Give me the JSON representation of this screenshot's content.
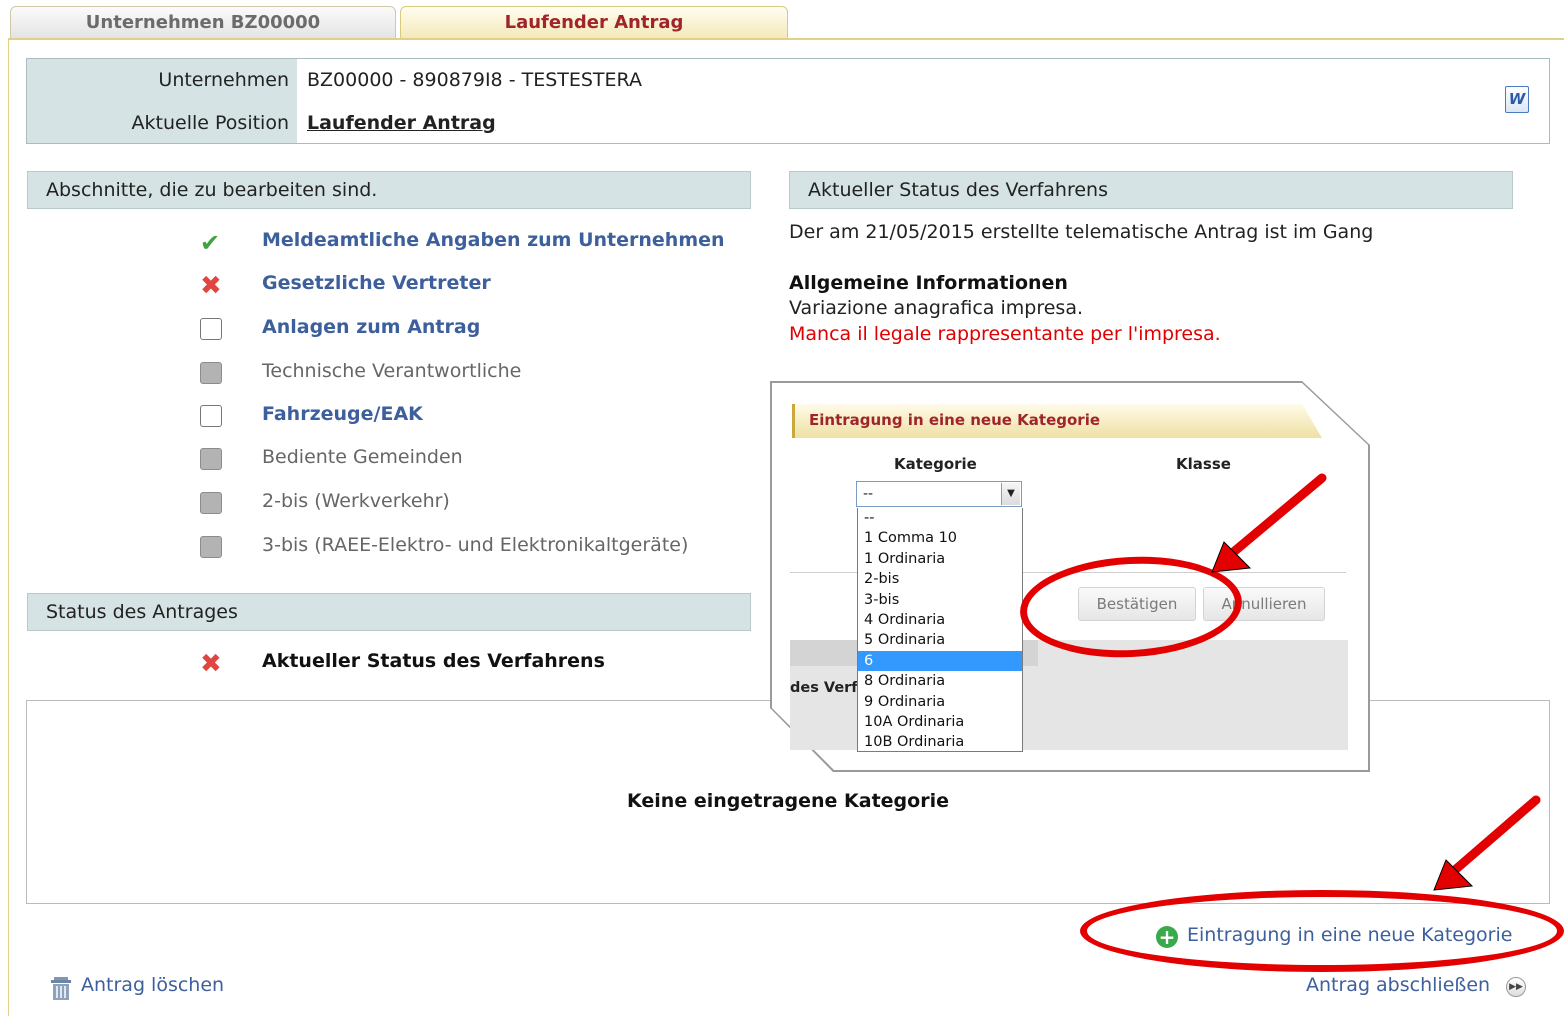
{
  "tabs": [
    {
      "label": "Unternehmen BZ00000",
      "active": false
    },
    {
      "label": "Laufender Antrag",
      "active": true
    }
  ],
  "info": {
    "company_label": "Unternehmen",
    "company_value": "BZ00000 - 890879I8 - TESTESTERA",
    "position_label": "Aktuelle Position",
    "position_value": "Laufender Antrag",
    "word_icon": "W"
  },
  "sections": {
    "header": "Abschnitte, die zu bearbeiten sind.",
    "items": [
      {
        "label": "Meldeamtliche Angaben zum Unternehmen",
        "state": "check"
      },
      {
        "label": "Gesetzliche Vertreter",
        "state": "cross"
      },
      {
        "label": "Anlagen zum Antrag",
        "state": "empty"
      },
      {
        "label": "Technische Verantwortliche",
        "state": "disabled"
      },
      {
        "label": "Fahrzeuge/EAK",
        "state": "empty"
      },
      {
        "label": "Bediente Gemeinden",
        "state": "disabled"
      },
      {
        "label": "2-bis (Werkverkehr)",
        "state": "disabled"
      },
      {
        "label": "3-bis (RAEE-Elektro- und Elektronikaltgeräte)",
        "state": "disabled"
      }
    ]
  },
  "status_antrag": {
    "header": "Status des Antrages",
    "item_label": "Aktueller Status des Verfahrens"
  },
  "status_verfahren": {
    "header": "Aktueller Status des Verfahrens",
    "text": "Der am 21/05/2015 erstellte telematische Antrag ist im Gang",
    "info_title": "Allgemeine Informationen",
    "info_line": "Variazione anagrafica impresa.",
    "error_line": "Manca il legale rappresentante per l'impresa."
  },
  "category_box": {
    "empty_text": "Keine eingetragene Kategorie"
  },
  "popup": {
    "title": "Eintragung in eine neue Kategorie",
    "col_kategorie": "Kategorie",
    "col_klasse": "Klasse",
    "select_value": "--",
    "options": [
      "--",
      "1 Comma 10",
      "1 Ordinaria",
      "2-bis",
      "3-bis",
      "4 Ordinaria",
      "5 Ordinaria",
      "6",
      "8 Ordinaria",
      "9 Ordinaria",
      "10A Ordinaria",
      "10B Ordinaria"
    ],
    "selected_option": "6",
    "confirm_label": "Bestätigen",
    "cancel_label": "Annullieren",
    "bg_text": "des Verf"
  },
  "actions": {
    "new_category": "Eintragung in eine neue Kategorie",
    "delete": "Antrag löschen",
    "finish": "Antrag abschließen"
  },
  "colors": {
    "annotation": "#e30000",
    "link": "#3d5f9c",
    "error": "#e00000",
    "tab_active_text": "#a0252a"
  }
}
